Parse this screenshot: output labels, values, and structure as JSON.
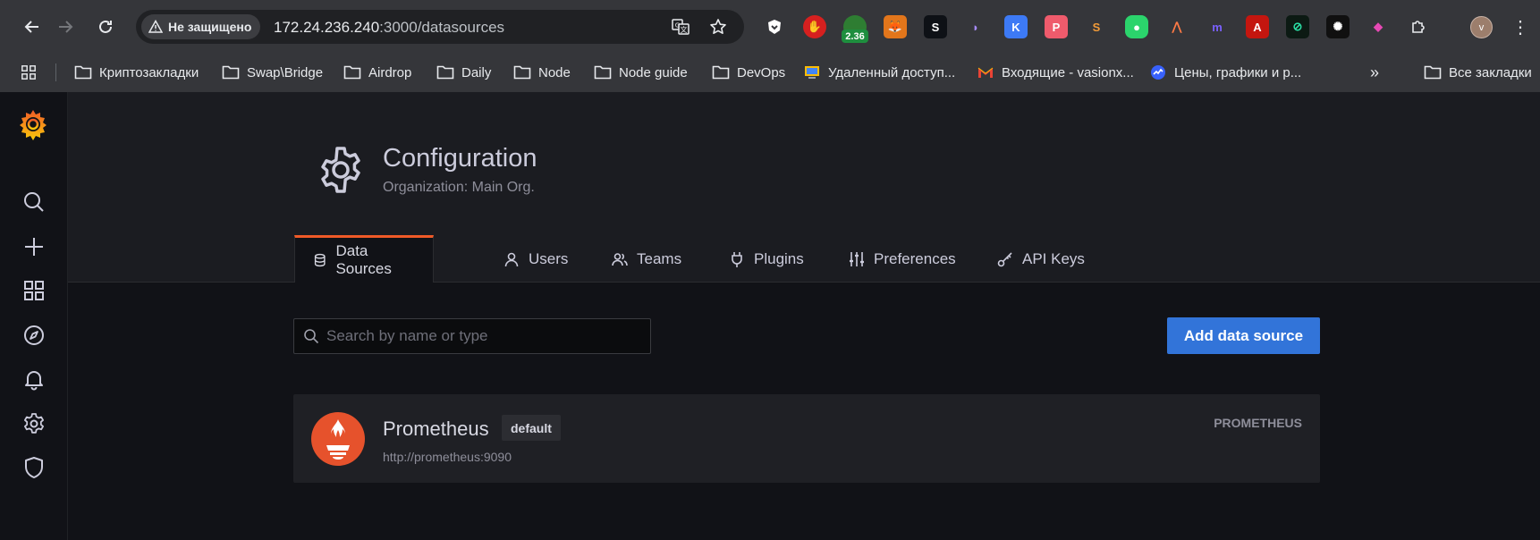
{
  "browser": {
    "security_label": "Не защищено",
    "url_host": "172.24.236.240",
    "url_path": ":3000/datasources",
    "extension_badge": "2.36",
    "profile_initial": "v",
    "bookmarks": [
      {
        "label": "Криптозакладки",
        "icon": "folder-icon"
      },
      {
        "label": "Swap\\Bridge",
        "icon": "folder-icon"
      },
      {
        "label": "Airdrop",
        "icon": "folder-icon"
      },
      {
        "label": "Daily",
        "icon": "folder-icon"
      },
      {
        "label": "Node",
        "icon": "folder-icon"
      },
      {
        "label": "Node guide",
        "icon": "folder-icon"
      },
      {
        "label": "DevOps",
        "icon": "folder-icon"
      },
      {
        "label": "Удаленный доступ...",
        "icon": "remote-desktop-icon"
      },
      {
        "label": "Входящие - vasionx...",
        "icon": "gmail-icon"
      },
      {
        "label": "Цены, графики и р...",
        "icon": "coinmarketcap-icon"
      }
    ],
    "all_bookmarks_label": "Все закладки"
  },
  "grafana": {
    "page": {
      "title": "Configuration",
      "subtitle": "Organization: Main Org."
    },
    "tabs": [
      {
        "label": "Data Sources",
        "icon": "database-icon",
        "active": true
      },
      {
        "label": "Users",
        "icon": "user-icon",
        "active": false
      },
      {
        "label": "Teams",
        "icon": "users-icon",
        "active": false
      },
      {
        "label": "Plugins",
        "icon": "plug-icon",
        "active": false
      },
      {
        "label": "Preferences",
        "icon": "sliders-icon",
        "active": false
      },
      {
        "label": "API Keys",
        "icon": "key-icon",
        "active": false
      }
    ],
    "search": {
      "placeholder": "Search by name or type",
      "value": ""
    },
    "add_button_label": "Add data source",
    "datasources": [
      {
        "name": "Prometheus",
        "badge": "default",
        "url": "http://prometheus:9090",
        "type": "PROMETHEUS"
      }
    ],
    "colors": {
      "accent": "#f05a28",
      "primary_button": "#3274d9",
      "prometheus": "#e6522c"
    }
  }
}
